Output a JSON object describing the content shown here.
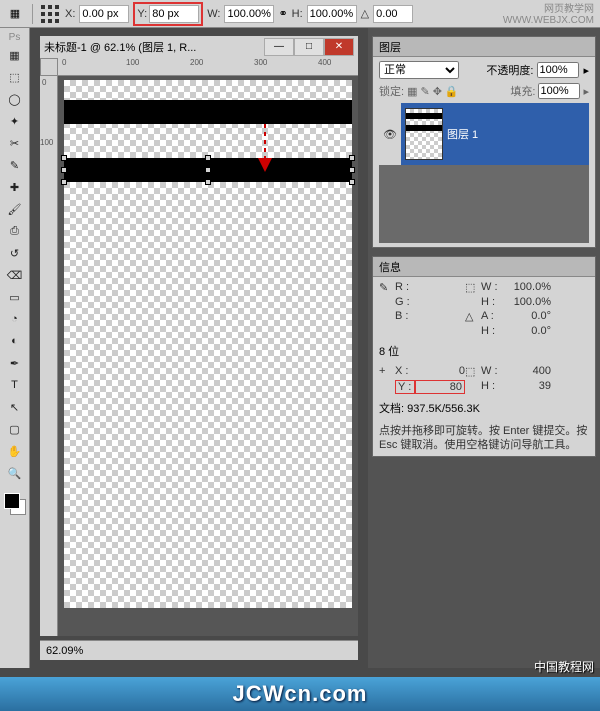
{
  "options_bar": {
    "x_label": "X:",
    "x_value": "0.00 px",
    "y_label": "Y:",
    "y_value": "80 px",
    "w_label": "W:",
    "w_value": "100.00%",
    "h_label": "H:",
    "h_value": "100.00%",
    "angle_label": "△",
    "angle_value": "0.00"
  },
  "document": {
    "title": "未标题-1 @ 62.1% (图层 1, R...",
    "zoom_status": "62.09%",
    "ruler_marks_top": [
      "0",
      "100",
      "200",
      "300",
      "400"
    ],
    "ruler_marks_left": [
      "0",
      "100"
    ]
  },
  "layers_panel": {
    "title": "图层",
    "blend_mode_label": "正常",
    "opacity_label": "不透明度:",
    "opacity_value": "100%",
    "lock_label": "锁定:",
    "fill_label": "填充:",
    "fill_value": "100%",
    "layer_name": "图层 1"
  },
  "info_panel": {
    "title": "信息",
    "rgb": {
      "R": "R :",
      "G": "G :",
      "B": "B :",
      "R_v": "",
      "G_v": "",
      "B_v": ""
    },
    "wh1": {
      "W": "W :",
      "H": "H :",
      "A": "A :",
      "Hh": "H :",
      "W_v": "100.0%",
      "H_v": "100.0%",
      "A_v": "0.0°",
      "Hh_v": "0.0°"
    },
    "eight_bit": "8 位",
    "xy": {
      "X": "X :",
      "Y": "Y :",
      "X_v": "0",
      "Y_v": "80"
    },
    "wh2": {
      "W": "W :",
      "H": "H :",
      "W_v": "400",
      "H_v": "39"
    },
    "doc_size_label": "文档:",
    "doc_size": "937.5K/556.3K",
    "hint": "点按并拖移即可旋转。按 Enter 键提交。按 Esc 键取消。使用空格键访问导航工具。"
  },
  "site": {
    "top_name": "网页教学网",
    "top_url": "WWW.WEBJX.COM",
    "bottom_cn": "中国教程网",
    "bottom_url": "JCWcn.com"
  },
  "tooltips": {
    "move": "▦",
    "marquee": "⬚",
    "lasso": "◯",
    "wand": "✦",
    "crop": "✂",
    "eyedrop": "✎",
    "heal": "✚",
    "brush": "🖌",
    "stamp": "⎙",
    "history": "↺",
    "eraser": "⌫",
    "gradient": "▭",
    "blur": "◔",
    "dodge": "◐",
    "pen": "✒",
    "type": "T",
    "path": "↖",
    "shape": "▢",
    "hand": "✋",
    "zoom": "🔍"
  }
}
